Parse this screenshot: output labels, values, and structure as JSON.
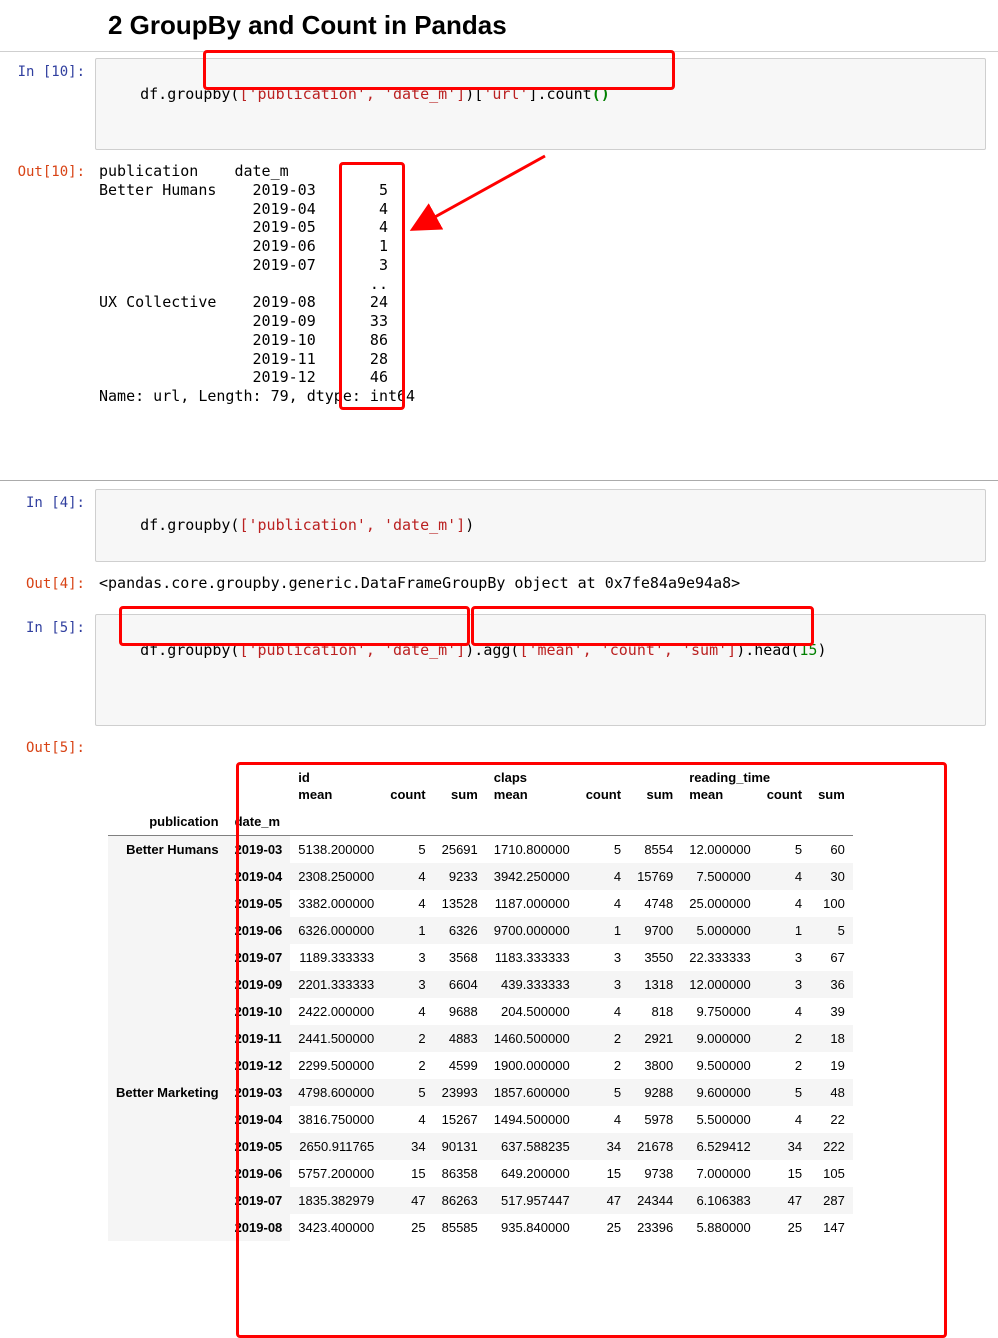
{
  "heading": "2  GroupBy and Count in Pandas",
  "cells": {
    "in10": {
      "prompt": "In [10]:",
      "code_pre": "df.groupby(",
      "code_args1": "['publication', 'date_m']",
      "code_mid": ")[",
      "code_args2": "'url'",
      "code_end": "].count",
      "code_par": "()"
    },
    "out10": {
      "prompt": "Out[10]:",
      "header": "publication    date_m ",
      "rows": [
        [
          "Better Humans",
          "2019-03",
          "5"
        ],
        [
          "",
          "2019-04",
          "4"
        ],
        [
          "",
          "2019-05",
          "4"
        ],
        [
          "",
          "2019-06",
          "1"
        ],
        [
          "",
          "2019-07",
          "3"
        ],
        [
          "",
          "",
          ".."
        ],
        [
          "UX Collective",
          "2019-08",
          "24"
        ],
        [
          "",
          "2019-09",
          "33"
        ],
        [
          "",
          "2019-10",
          "86"
        ],
        [
          "",
          "2019-11",
          "28"
        ],
        [
          "",
          "2019-12",
          "46"
        ]
      ],
      "footer": "Name: url, Length: 79, dtype: int64"
    },
    "in4": {
      "prompt": "In [4]:",
      "code_pre": "df.groupby(",
      "code_args1": "['publication', 'date_m']",
      "code_end": ")"
    },
    "out4": {
      "prompt": "Out[4]:",
      "text": "<pandas.core.groupby.generic.DataFrameGroupBy object at 0x7fe84a9e94a8>"
    },
    "in5": {
      "prompt": "In [5]:",
      "code_pre": "df.",
      "code_g": "groupby(",
      "code_args1": "['publication', 'date_m']",
      "code_g2": ")",
      "code_dot1": ".",
      "code_agg": "agg(",
      "code_args2": "['mean', 'count', 'sum']",
      "code_agg2": ")",
      "code_dot2": ".head(",
      "code_num": "15",
      "code_end": ")"
    },
    "out5": {
      "prompt": "Out[5]:"
    }
  },
  "table": {
    "topcols": [
      "id",
      "claps",
      "reading_time"
    ],
    "subcols": [
      "mean",
      "count",
      "sum"
    ],
    "index_names": [
      "publication",
      "date_m"
    ],
    "groups": [
      {
        "pub": "Better Humans",
        "rows": [
          [
            "2019-03",
            "5138.200000",
            5,
            "25691",
            "1710.800000",
            5,
            "8554",
            "12.000000",
            5,
            60
          ],
          [
            "2019-04",
            "2308.250000",
            4,
            "9233",
            "3942.250000",
            4,
            "15769",
            "7.500000",
            4,
            30
          ],
          [
            "2019-05",
            "3382.000000",
            4,
            "13528",
            "1187.000000",
            4,
            "4748",
            "25.000000",
            4,
            100
          ],
          [
            "2019-06",
            "6326.000000",
            1,
            "6326",
            "9700.000000",
            1,
            "9700",
            "5.000000",
            1,
            5
          ],
          [
            "2019-07",
            "1189.333333",
            3,
            "3568",
            "1183.333333",
            3,
            "3550",
            "22.333333",
            3,
            67
          ],
          [
            "2019-09",
            "2201.333333",
            3,
            "6604",
            "439.333333",
            3,
            "1318",
            "12.000000",
            3,
            36
          ],
          [
            "2019-10",
            "2422.000000",
            4,
            "9688",
            "204.500000",
            4,
            "818",
            "9.750000",
            4,
            39
          ],
          [
            "2019-11",
            "2441.500000",
            2,
            "4883",
            "1460.500000",
            2,
            "2921",
            "9.000000",
            2,
            18
          ],
          [
            "2019-12",
            "2299.500000",
            2,
            "4599",
            "1900.000000",
            2,
            "3800",
            "9.500000",
            2,
            19
          ]
        ]
      },
      {
        "pub": "Better Marketing",
        "rows": [
          [
            "2019-03",
            "4798.600000",
            5,
            "23993",
            "1857.600000",
            5,
            "9288",
            "9.600000",
            5,
            48
          ],
          [
            "2019-04",
            "3816.750000",
            4,
            "15267",
            "1494.500000",
            4,
            "5978",
            "5.500000",
            4,
            22
          ],
          [
            "2019-05",
            "2650.911765",
            34,
            "90131",
            "637.588235",
            34,
            "21678",
            "6.529412",
            34,
            222
          ],
          [
            "2019-06",
            "5757.200000",
            15,
            "86358",
            "649.200000",
            15,
            "9738",
            "7.000000",
            15,
            105
          ],
          [
            "2019-07",
            "1835.382979",
            47,
            "86263",
            "517.957447",
            47,
            "24344",
            "6.106383",
            47,
            287
          ],
          [
            "2019-08",
            "3423.400000",
            25,
            "85585",
            "935.840000",
            25,
            "23396",
            "5.880000",
            25,
            147
          ]
        ]
      }
    ]
  }
}
